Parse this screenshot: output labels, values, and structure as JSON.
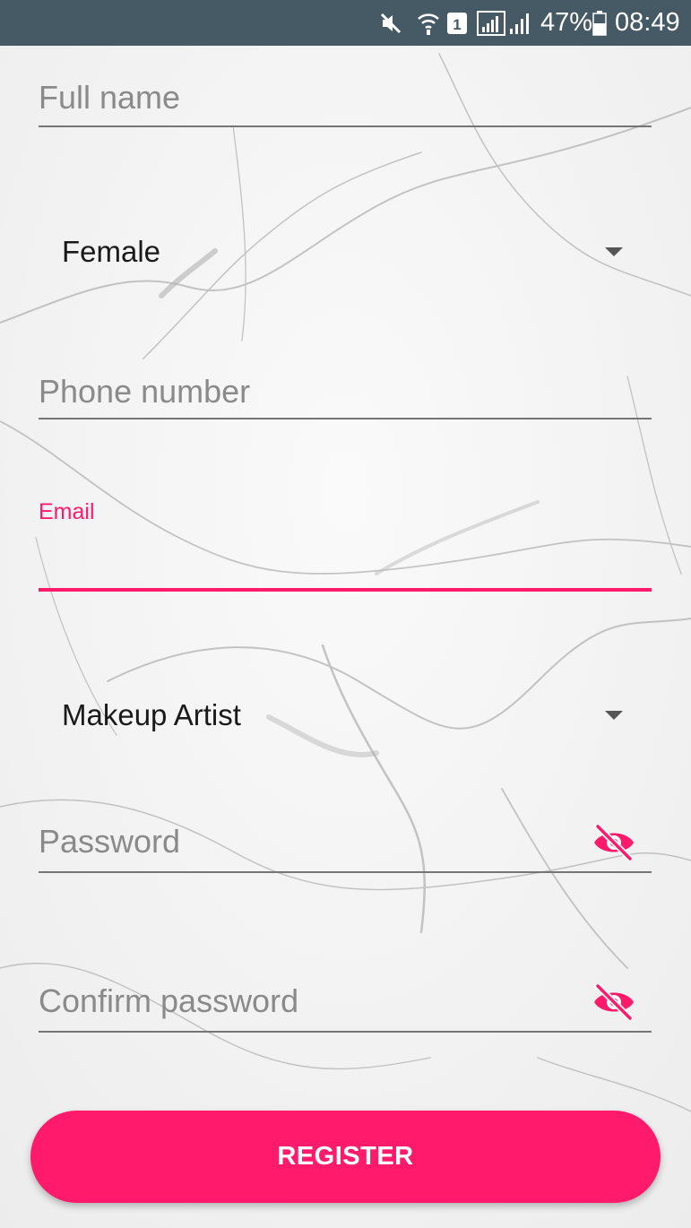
{
  "status_bar": {
    "icons": [
      "mute-icon",
      "wifi-icon",
      "sim-1-icon",
      "signal-icon",
      "signal-2-icon",
      "battery-icon"
    ],
    "battery_percent": "47%",
    "time": "08:49"
  },
  "form": {
    "full_name": {
      "placeholder": "Full name",
      "value": ""
    },
    "gender": {
      "selected": "Female"
    },
    "phone": {
      "placeholder": "Phone number",
      "value": ""
    },
    "email": {
      "label": "Email",
      "value": ""
    },
    "role": {
      "selected": "Makeup Artist"
    },
    "password": {
      "placeholder": "Password",
      "value": "",
      "toggle_icon": "eye-off-icon"
    },
    "confirm_password": {
      "placeholder": "Confirm password",
      "value": "",
      "toggle_icon": "eye-off-icon"
    },
    "register_label": "REGISTER"
  },
  "colors": {
    "accent": "#ff1a6c",
    "status_bar": "#455a64",
    "underline": "#757575",
    "hint_text": "#8a8a8a"
  }
}
